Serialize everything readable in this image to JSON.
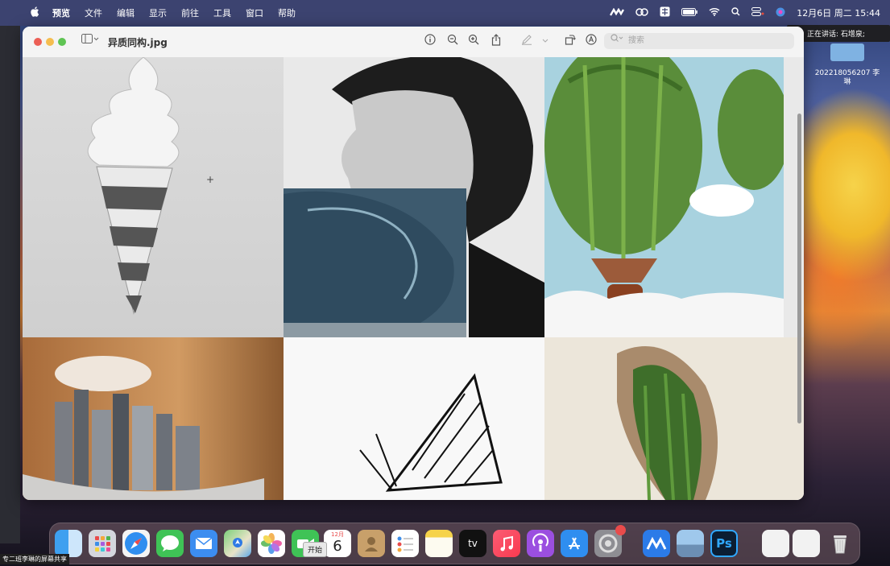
{
  "menubar": {
    "apple": "",
    "items": [
      "预览",
      "文件",
      "编辑",
      "显示",
      "前往",
      "工具",
      "窗口",
      "帮助"
    ],
    "datetime": "12月6日 周二 15:44"
  },
  "speaking": {
    "text": "正在讲话: 石增泉;"
  },
  "desktop": {
    "folder_label": "202218056207 李琳"
  },
  "window": {
    "title": "异质同构.jpg",
    "search_placeholder": "搜索"
  },
  "dock": {
    "calendar_month": "12月",
    "calendar_day": "6",
    "tv_label": "tv",
    "ps_label": "Ps",
    "tooltip": "开始"
  },
  "share_label": "专二班李琳的屏幕共享",
  "colors": {
    "menubar": "#3c4370",
    "close": "#ec5f56",
    "minimize": "#f5bd4f",
    "zoom": "#5fc453"
  }
}
